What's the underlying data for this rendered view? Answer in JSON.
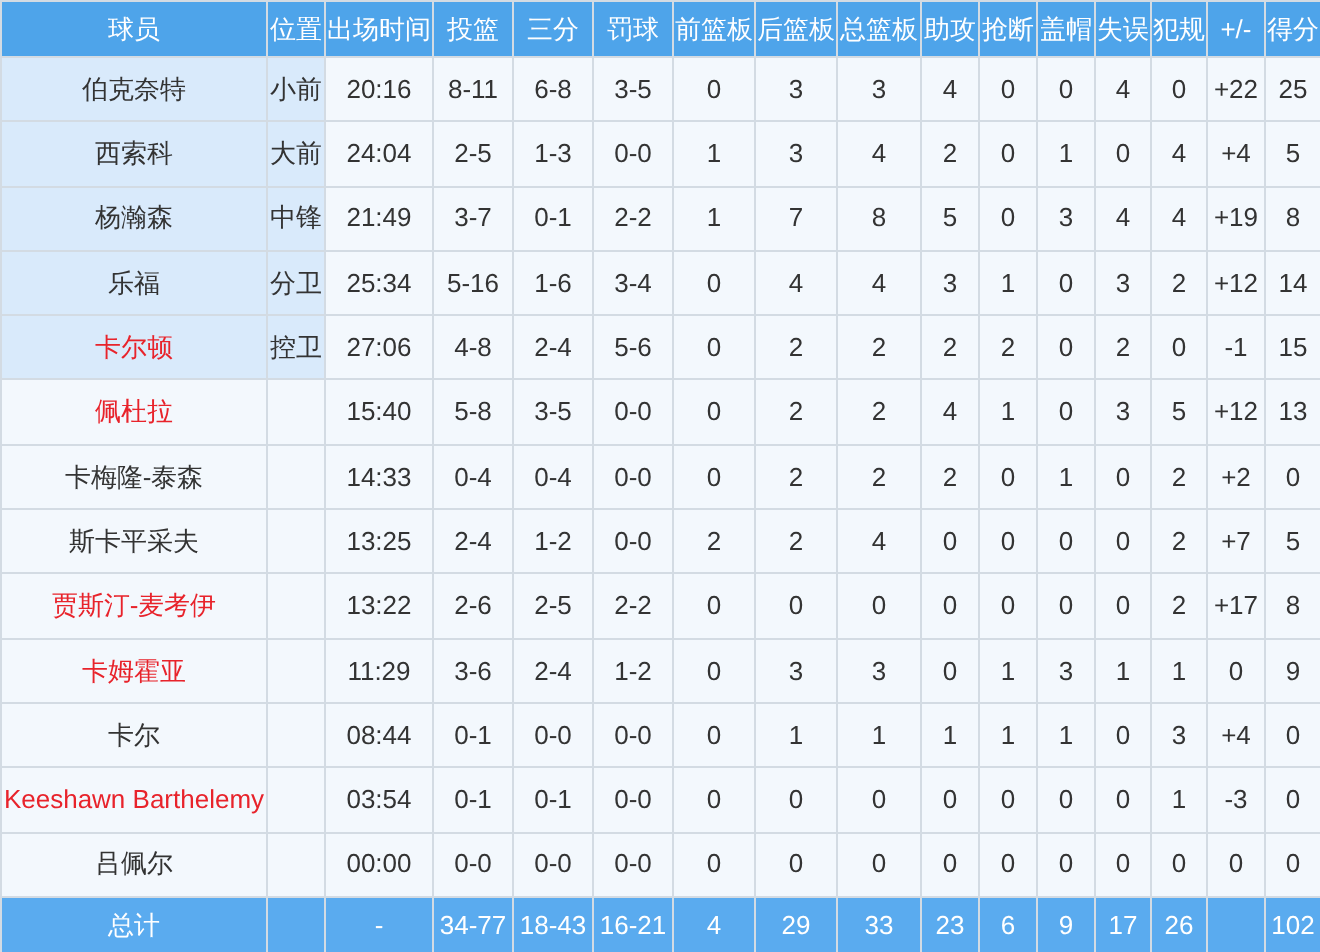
{
  "columns": [
    "球员",
    "位置",
    "出场时间",
    "投篮",
    "三分",
    "罚球",
    "前篮板",
    "后篮板",
    "总篮板",
    "助攻",
    "抢断",
    "盖帽",
    "失误",
    "犯规",
    "+/-",
    "得分"
  ],
  "rows": [
    {
      "name": "伯克奈特",
      "color": "#333333",
      "starter": true,
      "position": "小前",
      "stats": [
        "20:16",
        "8-11",
        "6-8",
        "3-5",
        "0",
        "3",
        "3",
        "4",
        "0",
        "0",
        "4",
        "0",
        "+22",
        "25"
      ]
    },
    {
      "name": "西索科",
      "color": "#333333",
      "starter": true,
      "position": "大前",
      "stats": [
        "24:04",
        "2-5",
        "1-3",
        "0-0",
        "1",
        "3",
        "4",
        "2",
        "0",
        "1",
        "0",
        "4",
        "+4",
        "5"
      ]
    },
    {
      "name": "杨瀚森",
      "color": "#333333",
      "starter": true,
      "position": "中锋",
      "stats": [
        "21:49",
        "3-7",
        "0-1",
        "2-2",
        "1",
        "7",
        "8",
        "5",
        "0",
        "3",
        "4",
        "4",
        "+19",
        "8"
      ]
    },
    {
      "name": "乐福",
      "color": "#333333",
      "starter": true,
      "position": "分卫",
      "stats": [
        "25:34",
        "5-16",
        "1-6",
        "3-4",
        "0",
        "4",
        "4",
        "3",
        "1",
        "0",
        "3",
        "2",
        "+12",
        "14"
      ]
    },
    {
      "name": "卡尔顿",
      "color": "#e8232b",
      "starter": true,
      "position": "控卫",
      "stats": [
        "27:06",
        "4-8",
        "2-4",
        "5-6",
        "0",
        "2",
        "2",
        "2",
        "2",
        "0",
        "2",
        "0",
        "-1",
        "15"
      ]
    },
    {
      "name": "佩杜拉",
      "color": "#e8232b",
      "starter": false,
      "stats": [
        "15:40",
        "5-8",
        "3-5",
        "0-0",
        "0",
        "2",
        "2",
        "4",
        "1",
        "0",
        "3",
        "5",
        "+12",
        "13"
      ]
    },
    {
      "name": "卡梅隆-泰森",
      "color": "#333333",
      "starter": false,
      "stats": [
        "14:33",
        "0-4",
        "0-4",
        "0-0",
        "0",
        "2",
        "2",
        "2",
        "0",
        "1",
        "0",
        "2",
        "+2",
        "0"
      ]
    },
    {
      "name": "斯卡平采夫",
      "color": "#333333",
      "starter": false,
      "stats": [
        "13:25",
        "2-4",
        "1-2",
        "0-0",
        "2",
        "2",
        "4",
        "0",
        "0",
        "0",
        "0",
        "2",
        "+7",
        "5"
      ]
    },
    {
      "name": "贾斯汀-麦考伊",
      "color": "#e8232b",
      "starter": false,
      "stats": [
        "13:22",
        "2-6",
        "2-5",
        "2-2",
        "0",
        "0",
        "0",
        "0",
        "0",
        "0",
        "0",
        "2",
        "+17",
        "8"
      ]
    },
    {
      "name": "卡姆霍亚",
      "color": "#e8232b",
      "starter": false,
      "stats": [
        "11:29",
        "3-6",
        "2-4",
        "1-2",
        "0",
        "3",
        "3",
        "0",
        "1",
        "3",
        "1",
        "1",
        "0",
        "9"
      ]
    },
    {
      "name": "卡尔",
      "color": "#333333",
      "starter": false,
      "stats": [
        "08:44",
        "0-1",
        "0-0",
        "0-0",
        "0",
        "1",
        "1",
        "1",
        "1",
        "1",
        "0",
        "3",
        "+4",
        "0"
      ]
    },
    {
      "name": "Keeshawn Barthelemy",
      "color": "#e8232b",
      "starter": false,
      "stats": [
        "03:54",
        "0-1",
        "0-1",
        "0-0",
        "0",
        "0",
        "0",
        "0",
        "0",
        "0",
        "0",
        "1",
        "-3",
        "0"
      ]
    },
    {
      "name": "吕佩尔",
      "color": "#333333",
      "starter": false,
      "stats": [
        "00:00",
        "0-0",
        "0-0",
        "0-0",
        "0",
        "0",
        "0",
        "0",
        "0",
        "0",
        "0",
        "0",
        "0",
        "0"
      ]
    }
  ],
  "totals": {
    "label": "总计",
    "time": "-",
    "stats": [
      "34-77",
      "18-43",
      "16-21",
      "4",
      "29",
      "33",
      "23",
      "6",
      "9",
      "17",
      "26"
    ],
    "points": "102"
  }
}
